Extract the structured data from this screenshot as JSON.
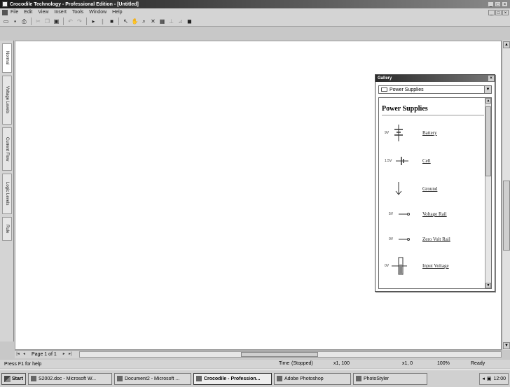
{
  "window": {
    "title": "Crocodile Technology - Professional Edition - [Untitled]",
    "buttons": [
      "_",
      "□",
      "×"
    ]
  },
  "menu": {
    "items": [
      "File",
      "Edit",
      "View",
      "Insert",
      "Tools",
      "Window",
      "Help"
    ],
    "doc_buttons": [
      "_",
      "□",
      "×"
    ]
  },
  "toolbar": {
    "buttons": [
      {
        "icon": "new-file-icon",
        "glyph": "▭"
      },
      {
        "icon": "save-icon",
        "glyph": "▪"
      },
      {
        "icon": "print-icon",
        "glyph": "⎙"
      },
      {
        "icon": "cut-icon",
        "glyph": "✂"
      },
      {
        "icon": "copy-icon",
        "glyph": "❐"
      },
      {
        "icon": "paste-icon",
        "glyph": "▣"
      },
      {
        "icon": "undo-icon",
        "glyph": "↶"
      },
      {
        "icon": "redo-icon",
        "glyph": "↷"
      },
      {
        "icon": "play-icon",
        "glyph": "▸"
      },
      {
        "icon": "pause-icon",
        "glyph": "❙"
      },
      {
        "icon": "stop-icon",
        "glyph": "■"
      },
      {
        "icon": "pointer-icon",
        "glyph": "↖"
      },
      {
        "icon": "hand-icon",
        "glyph": "✋"
      },
      {
        "icon": "zoom-icon",
        "glyph": "⌕"
      },
      {
        "icon": "delete-icon",
        "glyph": "✕"
      },
      {
        "icon": "parts-icon",
        "glyph": "▦"
      },
      {
        "icon": "align-icon",
        "glyph": "⊥"
      },
      {
        "icon": "graph-icon",
        "glyph": "⊿"
      },
      {
        "icon": "gallery-icon",
        "glyph": "◼"
      }
    ]
  },
  "side_tabs": [
    "Normal",
    "Voltage Levels",
    "Current Flow",
    "Logic Levels",
    "Rule"
  ],
  "pagebar": {
    "page_label": "Page 1 of 1",
    "nav": [
      "|◂",
      "◂",
      "▸",
      "▸|"
    ]
  },
  "status": {
    "help_text": "Press F1 for help",
    "time_label": "Time",
    "time_value": "(Stopped)",
    "speed": "x1, 100",
    "grid": "x1, 0",
    "zoom": "100%",
    "state": "Ready"
  },
  "gallery": {
    "title": "Gallery",
    "close": "×",
    "folder": "Power Supplies",
    "heading": "Power Supplies",
    "items": [
      {
        "label": "Battery",
        "symbol": "battery-icon",
        "text": "9V"
      },
      {
        "label": "Cell",
        "symbol": "cell-icon",
        "text": "1.5V"
      },
      {
        "label": "Ground",
        "symbol": "ground-icon",
        "text": ""
      },
      {
        "label": "Voltage Rail",
        "symbol": "voltage-rail-icon",
        "text": "5V"
      },
      {
        "label": "Zero Volt Rail",
        "symbol": "zero-volt-rail-icon",
        "text": "0V"
      },
      {
        "label": "Input Voltage",
        "symbol": "input-voltage-icon",
        "text": "0V"
      }
    ]
  },
  "taskbar": {
    "start": "Start",
    "tasks": [
      {
        "label": "S2002.doc - Microsoft W...",
        "active": false
      },
      {
        "label": "Document2 - Microsoft ...",
        "active": false
      },
      {
        "label": "Crocodile - Profession...",
        "active": true
      },
      {
        "label": "Adobe Photoshop",
        "active": false
      },
      {
        "label": "PhotoStyler",
        "active": false
      }
    ],
    "clock": "12:00"
  }
}
